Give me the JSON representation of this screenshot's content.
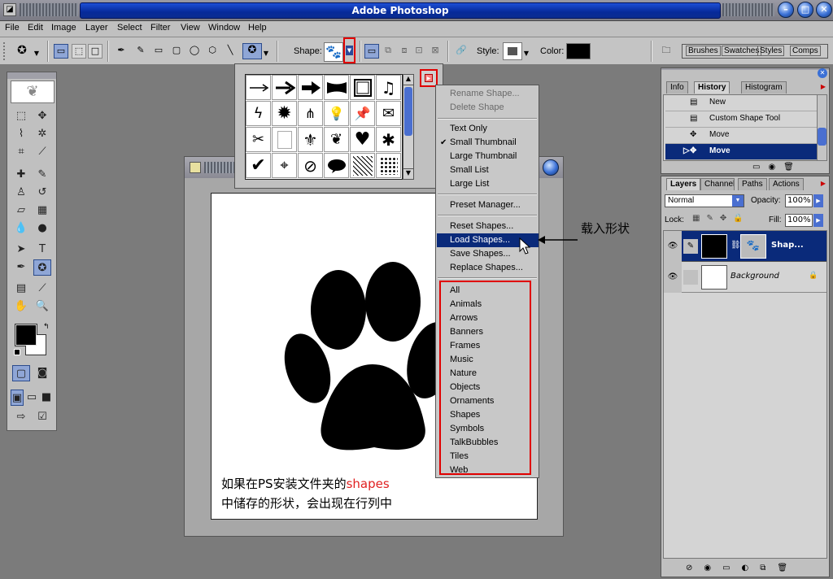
{
  "app": {
    "title": "Adobe Photoshop"
  },
  "menubar": [
    "File",
    "Edit",
    "Image",
    "Layer",
    "Select",
    "Filter",
    "View",
    "Window",
    "Help"
  ],
  "optionsbar": {
    "shape_label": "Shape:",
    "style_label": "Style:",
    "color_label": "Color:",
    "color_value": "#000000",
    "palette_well": [
      "Brushes",
      "Swatches",
      "Styles",
      "Comps"
    ]
  },
  "shape_grid": [
    "arrow-thin",
    "arrow-bold",
    "arrow-heavy",
    "banner",
    "frame",
    "music-note",
    "lightning",
    "starburst",
    "grass",
    "lightbulb",
    "thumbtack",
    "envelope",
    "scissors",
    "blank-tile",
    "fleur-de-lis",
    "puzzle-shape",
    "heart",
    "blob",
    "checkmark",
    "target",
    "no-symbol",
    "speech-bubble",
    "hatched-tile",
    "diamond-checker"
  ],
  "menu": {
    "group1": [
      {
        "label": "Rename Shape...",
        "disabled": true
      },
      {
        "label": "Delete Shape",
        "disabled": true
      }
    ],
    "group2": [
      {
        "label": "Text Only"
      },
      {
        "label": "Small Thumbnail",
        "checked": true
      },
      {
        "label": "Large Thumbnail"
      },
      {
        "label": "Small List"
      },
      {
        "label": "Large List"
      }
    ],
    "group3": [
      {
        "label": "Preset Manager..."
      }
    ],
    "group4": [
      {
        "label": "Reset Shapes..."
      },
      {
        "label": "Load Shapes...",
        "highlighted": true
      },
      {
        "label": "Save Shapes..."
      },
      {
        "label": "Replace Shapes..."
      }
    ],
    "libraries": [
      "All",
      "Animals",
      "Arrows",
      "Banners",
      "Frames",
      "Music",
      "Nature",
      "Objects",
      "Ornaments",
      "Shapes",
      "Symbols",
      "TalkBubbles",
      "Tiles",
      "Web"
    ]
  },
  "annotation": {
    "load_label": "载入形状",
    "caption_line1_a": "如果在PS安装文件夹的",
    "caption_line1_b": "shapes",
    "caption_line2": "中储存的形状，会出现在行列中"
  },
  "history": {
    "tabs": [
      "Info",
      "History",
      "Histogram"
    ],
    "active_tab": "History",
    "items": [
      {
        "label": "New"
      },
      {
        "label": "Custom Shape Tool"
      },
      {
        "label": "Move"
      },
      {
        "label": "Move",
        "selected": true
      }
    ]
  },
  "layers_panel": {
    "tabs": [
      "Layers",
      "Channels",
      "Paths",
      "Actions"
    ],
    "active_tab": "Layers",
    "blend_mode": "Normal",
    "opacity_label": "Opacity:",
    "opacity": "100%",
    "lock_label": "Lock:",
    "fill_label": "Fill:",
    "fill": "100%",
    "layers": [
      {
        "name": "Shap...",
        "selected": true
      },
      {
        "name": "Background",
        "italic": true
      }
    ]
  },
  "colors": {
    "accent": "#0a2a7a",
    "annotation_red": "#e00000",
    "shapes_red": "#e02020"
  }
}
